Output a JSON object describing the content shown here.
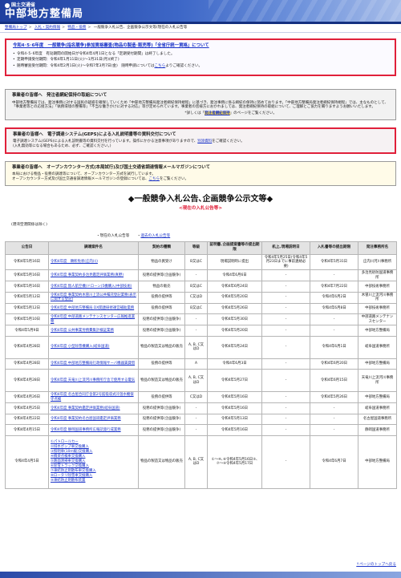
{
  "header": {
    "org_small": "国土交通省",
    "org_big": "中部地方整備局"
  },
  "breadcrumb": [
    {
      "label": "整備局トップ",
      "link": true
    },
    {
      "label": "入札・契約情報",
      "link": true
    },
    {
      "label": "物品・役務",
      "link": true
    },
    {
      "label": "一般競争入札公告、企画競争公示文等(現在の入札公告等",
      "link": false
    }
  ],
  "notice_qual": {
    "title": "令和4･5･6年度　一般競争(指名競争)参加資格審査(物品の製造･販売等)「全省庁統一資格」について",
    "items": [
      "令和4･5･6年度　有効期間の開始日が令和4年4月1日となる「定期受付期間」は終了しました。",
      "定期申請受付期間：令和4年1月11日(火)〜1月31日(月)(終了)",
      "随時審査受付期間：令和4年2月1日(火)〜令和7年3月7日(金)　随時申請については",
      "こちら",
      "よりご確認ください。"
    ]
  },
  "notice_wage": {
    "title": "事業者の皆様へ　発注者綱紀保持の取組について",
    "body": "中部地方整備局では、発注事務に対する国民の疑惑を確保していくため「中部地方整備局発注者綱紀保持規程」に基づき、発注事務に係る綱紀の保持に努めております。「中部地方整備局発注者綱紀保持規程」では、主なものとして、「事業者等との応接方法」「執務環境の整備等」「不当な働きかけに対する対応」等が定められています。事業者の皆様方におかれましては、発注者綱紀保持の取組について、ご理解とご協力を賜りますようお願いいたします。",
    "detail_prefix": "*詳しくは「",
    "detail_link": "発注者綱紀保持",
    "detail_suffix": "」のページをご覧ください。"
  },
  "notice_geps": {
    "title": "事業者の皆様へ　電子調達システム(GEPS)による入札説明書等の資料交付について",
    "body1": "電子調達システム(GEPS)による入札説明書等の資料交付を行っています。操作にかかる注意事項がありますので、",
    "link": "別添資料",
    "body2": "をご確認ください。",
    "body3": "(入札無効等になる場合もあるため、必ず、ご確認ください。)"
  },
  "notice_open": {
    "title": "事業者の皆様へ　オープンカウンター方式(本局試行)及び国土交通省調達情報メールマガジンについて",
    "body1": "本局における物品・役務の調達等について、オープンカウンター方式を試行しています。",
    "body2": "オープンカウンター方式及び国土交通省調達情報メールマガジンの登録については、",
    "link": "こちら",
    "body3": "をご覧ください。"
  },
  "section": {
    "title": "◆一般競争入札公告､企画競争公示文等◆",
    "subtitle": "<現在の入札公告等>",
    "exclusion": "(港湾空港関係は除く)",
    "nav_current": "・現在の入札公告等",
    "nav_sep": "・",
    "nav_past": "過去の入札公告等"
  },
  "table": {
    "headers": [
      "公告日",
      "調達案件名",
      "契約の種類",
      "等級",
      "証明書､企画提案書等の提出期限",
      "机上､現場説明日",
      "入札書等の提出期限",
      "発注事務所名"
    ],
    "rows": [
      {
        "date": "令和4年5月16日",
        "name": "令和4年度　顕彰免状(庄内川)",
        "type": "物品の買受け",
        "grade": "B又はC",
        "cert": "現場説明時に提出",
        "desk": "令和4年5月25日(令和4年5月23日までに事前連絡必要)",
        "bid": "令和4年5月31日",
        "office": "庄内川河川事務所"
      },
      {
        "date": "令和4年5月16日",
        "name": "令和4年度 事業契約多治見鑑定評価業務(真野)",
        "type": "役務の提供等(企画競争)",
        "grade": "-",
        "cert": "令和4年6月6日",
        "desk": "-",
        "bid": "-",
        "office": "多治見砂防国道事務所"
      },
      {
        "date": "令和4年5月16日",
        "name": "令和4年度 無人航空機(ドローン)5機購入(中部技術)",
        "type": "物品の販売",
        "grade": "B又はC",
        "cert": "令和4年6月24日",
        "desk": "-",
        "bid": "令和4年7月22日",
        "office": "中部技術事務所"
      },
      {
        "date": "令和4年5月12日",
        "name": "令和4年度 事業契約木曽川上流公共嘱託登記業務(表示に関する登記)",
        "type": "役務の提供等",
        "grade": "C又はD",
        "cert": "令和4年5月20日",
        "desk": "-",
        "bid": "令和4年6月2日",
        "office": "木曽川上流河川事務所"
      },
      {
        "date": "令和4年5月12日",
        "name": "令和4年度 中部地方整備局 DX関連研修運営補助業務",
        "type": "役務の提供等",
        "grade": "B又はC",
        "cert": "令和4年5月26日",
        "desk": "-",
        "bid": "令和4年6月8日",
        "office": "中部技術事務所"
      },
      {
        "date": "令和4年5月10日",
        "name": "令和4年度 中部道路メンテナンスセンター広報推進業務",
        "type": "役務の提供等(企画競争)",
        "grade": "-",
        "cert": "令和4年5月30日",
        "desk": "-",
        "bid": "-",
        "office": "中部道路メンテナンスセンター"
      },
      {
        "date": "令和4年5月9日",
        "name": "令和4年度 公共事業労務費集計検証業務",
        "type": "役務の提供等(企画競争)",
        "grade": "-",
        "cert": "令和4年5月20日",
        "desk": "-",
        "bid": "-",
        "office": "中部地方整備局"
      },
      {
        "date": "令和4年4月28日",
        "name": "令和4年度 小型除雪機購入(岐阜国道)",
        "type": "物品の製造又は物品の販売",
        "grade": "A, B, C又はD",
        "cert": "令和4年5月24日",
        "desk": "-",
        "bid": "令和4年6月1日",
        "office": "岐阜国道事務所",
        "tall": true
      },
      {
        "date": "令和4年4月28日",
        "name": "令和4年度 中部地方整備局行政情報サーバ機器賃貸借",
        "type": "役務の提供等",
        "grade": "A",
        "cert": "令和4年6月3日",
        "desk": "-",
        "bid": "令和4年6月20日",
        "office": "中部地方整備局"
      },
      {
        "date": "令和4年4月28日",
        "name": "令和4年度 天竜川上流河川事務所庁舎で使用する電気",
        "type": "物品の製造又は物品の販売",
        "grade": "A, B, C又はD",
        "cert": "令和4年5月27日",
        "desk": "-",
        "bid": "令和4年6月15日",
        "office": "天竜川上流河川事務所",
        "tall": true
      },
      {
        "date": "令和4年4月26日",
        "name": "令和4年度 名古屋合同庁舎第2号館吸収式冷温水機保守点検",
        "type": "役務の提供等",
        "grade": "C又はD",
        "cert": "令和4年5月16日",
        "desk": "-",
        "bid": "令和4年5月26日",
        "office": "中部地方整備局"
      },
      {
        "date": "令和4年4月25日",
        "name": "令和4年度 事業契約鑑定評価業務(岐阜国道)",
        "type": "役務の提供等(企画競争)",
        "grade": "-",
        "cert": "令和4年5月16日",
        "desk": "-",
        "bid": "-",
        "office": "岐阜国道事務所"
      },
      {
        "date": "令和4年4月22日",
        "name": "令和4年度 事業契約名古屋国道鑑定評価業務",
        "type": "役務の提供等(企画競争)",
        "grade": "-",
        "cert": "令和4年5月13日",
        "desk": "-",
        "bid": "-",
        "office": "名古屋国道事務所"
      },
      {
        "date": "令和4年4月15日",
        "name": "令和4年度 静岡国道事務所広報誌発行成業務",
        "type": "役務の提供等(企画競争)",
        "grade": "-",
        "cert": "令和4年5月16日",
        "desk": "-",
        "bid": "-",
        "office": "静岡国道事務所"
      },
      {
        "date": "令和4年4月5日",
        "items": [
          "①パトロールカー",
          "②排水ポンプ車交換購入",
          "③照明車(10m級)交換購入",
          "④橋梁点検車交換購入",
          "⑤路面清掃車交換購入",
          "⑥除雪トラック交換購入",
          "⑦凍結防止剤散布車交換購入",
          "⑧ロータリ除雪車交換購入",
          "⑨凍結防止剤散布装置"
        ],
        "type": "物品の製造又は物品の販売",
        "grade": "A, B, C又はD",
        "cert": "①〜④､⑥令和4年5月16日⑤､⑦〜⑨令和4年5月17日",
        "desk": "-",
        "bid": "令和4年6月7日",
        "office": "中部地方整備局",
        "big": true
      }
    ]
  },
  "footer": {
    "pagetop": "↑ページのトップへ戻る"
  }
}
